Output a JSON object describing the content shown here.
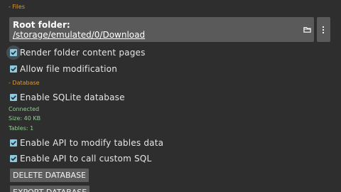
{
  "files": {
    "header": "- Files",
    "root_folder": {
      "title": "Root folder:",
      "path": "/storage/emulated/0/Download",
      "browse_icon": "folder-icon",
      "menu_icon": "kebab-menu-icon"
    },
    "options": [
      {
        "label": "Render folder content pages",
        "checked": true
      },
      {
        "label": "Allow file modification",
        "checked": true
      }
    ]
  },
  "database": {
    "header": "- Database",
    "enable_sqlite": {
      "label": "Enable SQLite database",
      "checked": true
    },
    "status": {
      "connected": "Connected",
      "size": "Size: 40 KB",
      "tables": "Tables: 1"
    },
    "api_options": [
      {
        "label": "Enable API to modify tables data",
        "checked": true
      },
      {
        "label": "Enable API to call custom SQL",
        "checked": true
      }
    ],
    "buttons": {
      "delete": "DELETE DATABASE",
      "export": "EXPORT DATABASE"
    }
  },
  "colors": {
    "background": "#2e2e2e",
    "section_header": "#d89a3a",
    "checkbox": "#8ec9e0",
    "status_text": "#8fd08f",
    "card": "#5a5a5a"
  }
}
